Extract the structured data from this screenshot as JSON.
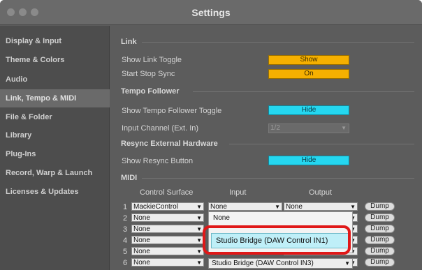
{
  "window": {
    "title": "Settings"
  },
  "sidebar": {
    "items": [
      {
        "label": "Display & Input"
      },
      {
        "label": "Theme & Colors"
      },
      {
        "label": "Audio"
      },
      {
        "label": "Link, Tempo & MIDI",
        "active": true
      },
      {
        "label": "File & Folder"
      },
      {
        "label": "Library"
      },
      {
        "label": "Plug-Ins"
      },
      {
        "label": "Record, Warp & Launch"
      },
      {
        "label": "Licenses & Updates"
      }
    ]
  },
  "link": {
    "header": "Link",
    "show_link_toggle_label": "Show Link Toggle",
    "show_link_toggle_value": "Show",
    "start_stop_sync_label": "Start Stop Sync",
    "start_stop_sync_value": "On"
  },
  "tempo_follower": {
    "header": "Tempo Follower",
    "show_toggle_label": "Show Tempo Follower Toggle",
    "show_toggle_value": "Hide",
    "input_channel_label": "Input Channel (Ext. In)",
    "input_channel_value": "1/2"
  },
  "resync": {
    "header": "Resync External Hardware",
    "show_button_label": "Show Resync Button",
    "show_button_value": "Hide"
  },
  "midi": {
    "header": "MIDI",
    "columns": {
      "control_surface": "Control Surface",
      "input": "Input",
      "output": "Output"
    },
    "dump_label": "Dump",
    "rows": [
      {
        "num": "1",
        "surface": "MackieControl",
        "input": "None",
        "output": "None"
      },
      {
        "num": "2",
        "surface": "None",
        "input": "",
        "output": ""
      },
      {
        "num": "3",
        "surface": "None",
        "input": "",
        "output": ""
      },
      {
        "num": "4",
        "surface": "None",
        "input": "",
        "output": ""
      },
      {
        "num": "5",
        "surface": "None",
        "input": "",
        "output": ""
      },
      {
        "num": "6",
        "surface": "None",
        "input": "",
        "output": ""
      }
    ],
    "input_popup": {
      "options": [
        {
          "label": "None"
        },
        {
          "label": "Studio Bridge (DAW Control IN1)",
          "selected": true
        }
      ]
    },
    "row6_input_value": "Studio Bridge (DAW Control IN3)"
  },
  "colors": {
    "yellow_button": "#f5b000",
    "cyan_button": "#25d7f0",
    "highlight": "#e01818"
  }
}
